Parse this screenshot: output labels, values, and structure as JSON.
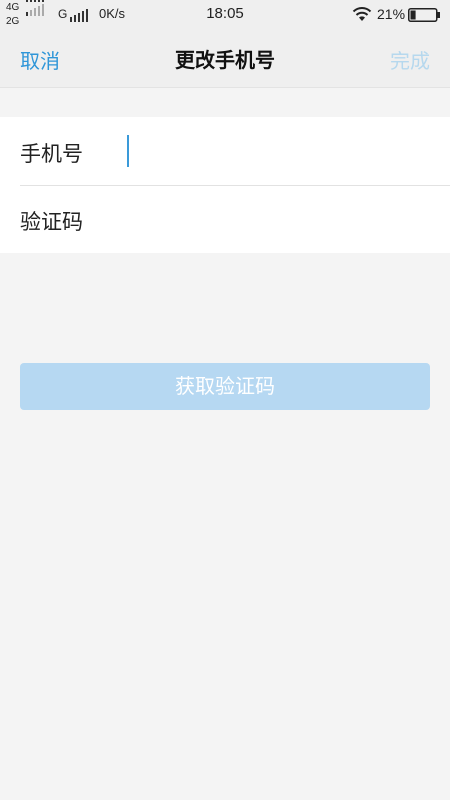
{
  "status_bar": {
    "network_top": "4G",
    "network_bottom": "2G",
    "network_g": "G",
    "speed": "0K/s",
    "time": "18:05",
    "battery_percent": "21%",
    "battery_level": 0.21
  },
  "nav": {
    "cancel_label": "取消",
    "title": "更改手机号",
    "done_label": "完成"
  },
  "form": {
    "phone_label": "手机号",
    "phone_value": "",
    "code_label": "验证码",
    "code_value": ""
  },
  "actions": {
    "get_code_label": "获取验证码"
  },
  "colors": {
    "accent": "#2f96d8",
    "accent_disabled": "#b6d8ee",
    "button_disabled_bg": "#b6d8f2",
    "background": "#f4f4f4"
  },
  "icons": [
    "signal-icon",
    "wifi-icon",
    "battery-icon"
  ]
}
